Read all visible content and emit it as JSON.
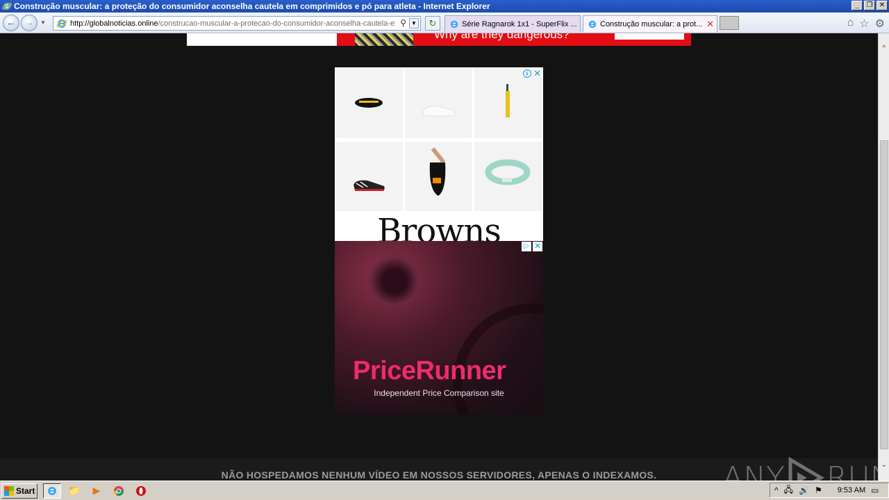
{
  "window": {
    "title": "Construção muscular: a proteção do consumidor aconselha cautela em comprimidos e pó para atleta - Internet Explorer",
    "controls": [
      "_",
      "❐",
      "✕"
    ]
  },
  "navbar": {
    "url_domain": "http://globalnoticias.online",
    "url_path": "/construcao-muscular-a-protecao-do-consumidor-aconselha-cautela-em",
    "tabs": [
      {
        "label": "Série Ragnarok 1x1 - SuperFlix ...",
        "active": false
      },
      {
        "label": "Construção muscular: a prot...",
        "active": true
      }
    ]
  },
  "page": {
    "top_banner_headline": "Why are they dangerous?",
    "ad1": {
      "brand": "Browns",
      "products": [
        "belt-bag",
        "white-sneaker",
        "yellow-keychain",
        "black-sneaker",
        "black-crossbody-bag",
        "mint-belt"
      ]
    },
    "ad2": {
      "brand": "PriceRunner",
      "tagline": "Independent Price Comparison site"
    },
    "footer_message": "NÃO HOSPEDAMOS NENHUM VÍDEO EM NOSSOS SERVIDORES, APENAS O INDEXAMOS.",
    "watermark": {
      "left": "ANY",
      "right": "RUN"
    }
  },
  "taskbar": {
    "start_label": "Start",
    "clock": "9:53 AM"
  },
  "colors": {
    "page_bg": "#131313",
    "ad_red": "#e30d14",
    "pricerunner_pink": "#f02a6f",
    "adchoices_blue": "#1aa0d8"
  }
}
